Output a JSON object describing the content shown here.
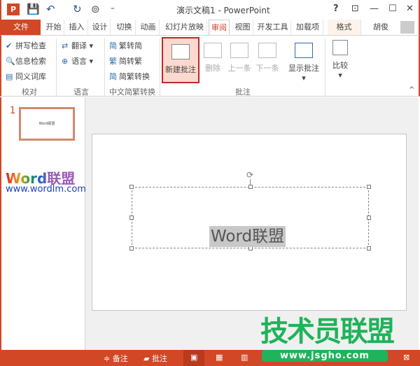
{
  "window": {
    "title": "演示文稿1 - PowerPoint",
    "help": "?",
    "restore_ribbon": "⊡",
    "minimize": "—",
    "maximize": "☐",
    "close": "✕"
  },
  "quick_access": {
    "app_icon": "P",
    "save": "💾",
    "undo": "↶",
    "redo": "↻",
    "presenter": "⊚",
    "customize": "⁼"
  },
  "tabs": [
    {
      "label": "文件"
    },
    {
      "label": "开始"
    },
    {
      "label": "插入"
    },
    {
      "label": "设计"
    },
    {
      "label": "切换"
    },
    {
      "label": "动画"
    },
    {
      "label": "幻灯片放映"
    },
    {
      "label": "审阅"
    },
    {
      "label": "视图"
    },
    {
      "label": "开发工具"
    },
    {
      "label": "加载项"
    },
    {
      "label": "格式"
    }
  ],
  "user": {
    "name": "胡俊"
  },
  "ribbon": {
    "proofing": {
      "items": [
        "拼写检查",
        "信息检索",
        "同义词库"
      ],
      "group": "校对"
    },
    "language": {
      "items": [
        "翻译",
        "语言"
      ],
      "group": "语言"
    },
    "chinese": {
      "items": [
        "繁转简",
        "简转繁",
        "简繁转换"
      ],
      "group": "中文简繁转换"
    },
    "comments": {
      "new": "新建批注",
      "delete": "删除",
      "prev": "上一条",
      "next": "下一条",
      "show": "显示批注",
      "group": "批注"
    },
    "compare": {
      "label": "比较"
    }
  },
  "thumbnail": {
    "number": "1",
    "text": "Word联盟"
  },
  "logo": {
    "word": "Word联盟",
    "url": "www.wordlm.com"
  },
  "slide": {
    "text": "Word联盟"
  },
  "status": {
    "notes": "备注",
    "comments": "批注"
  },
  "watermark": {
    "text": "技术员联盟",
    "url": "www.jsgho.com"
  },
  "colors": {
    "accent": "#d24726",
    "watermark": "#1fb35a"
  }
}
